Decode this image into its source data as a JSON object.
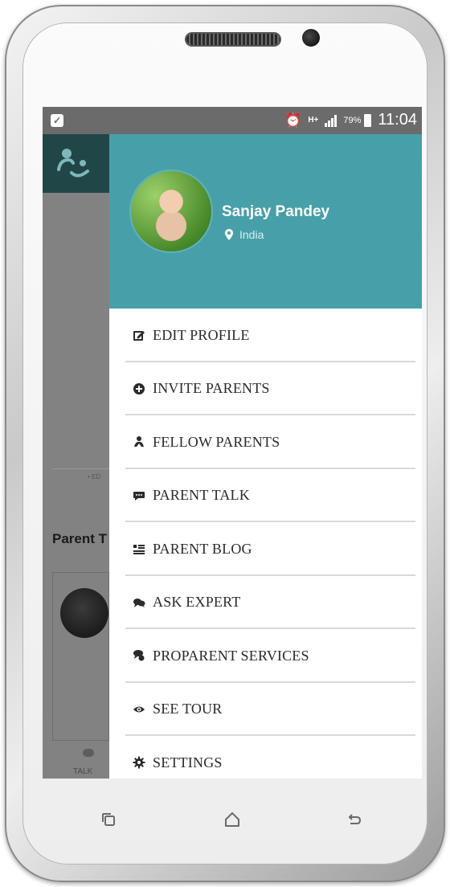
{
  "status_bar": {
    "battery": "79%",
    "time": "11:04",
    "network": "H+"
  },
  "background_app": {
    "section_title": "Parent T",
    "tab_label": "TALK",
    "tiny_text": "• ED"
  },
  "profile": {
    "name": "Sanjay Pandey",
    "location": "India"
  },
  "menu": [
    {
      "label": "EDIT PROFILE",
      "icon": "edit-icon"
    },
    {
      "label": "INVITE PARENTS",
      "icon": "plus-circle-icon"
    },
    {
      "label": "FELLOW PARENTS",
      "icon": "people-icon"
    },
    {
      "label": "PARENT TALK",
      "icon": "chat-bubble-icon"
    },
    {
      "label": "PARENT BLOG",
      "icon": "blog-list-icon"
    },
    {
      "label": "ASK EXPERT",
      "icon": "speech-bubbles-icon"
    },
    {
      "label": "PROPARENT SERVICES",
      "icon": "services-icon"
    },
    {
      "label": "SEE TOUR",
      "icon": "eye-icon"
    },
    {
      "label": "SETTINGS",
      "icon": "gear-icon"
    }
  ],
  "colors": {
    "drawer_header": "#47a0a9",
    "logo_block": "#214648",
    "menu_text": "#2b2b2b"
  }
}
